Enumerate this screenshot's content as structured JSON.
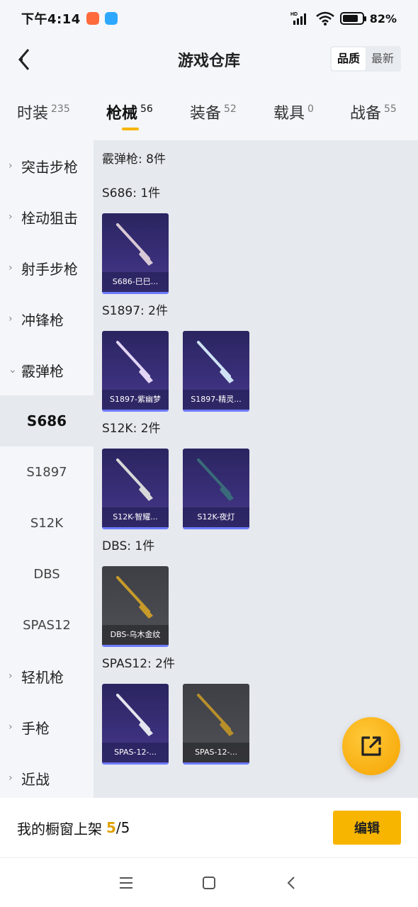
{
  "status_bar": {
    "time": "下午4:14",
    "battery": "82%",
    "hd_label": "HD",
    "battery_level": 0.82
  },
  "header": {
    "title": "游戏仓库",
    "sort_options": [
      "品质",
      "最新"
    ],
    "sort_active": "品质"
  },
  "category_tabs": [
    {
      "label": "时装",
      "count": "235"
    },
    {
      "label": "枪械",
      "count": "56",
      "active": true
    },
    {
      "label": "装备",
      "count": "52"
    },
    {
      "label": "载具",
      "count": "0"
    },
    {
      "label": "战备",
      "count": "55"
    }
  ],
  "side_nav": {
    "items": [
      {
        "label": "突击步枪",
        "chevron": "right"
      },
      {
        "label": "栓动狙击",
        "chevron": "right"
      },
      {
        "label": "射手步枪",
        "chevron": "right"
      },
      {
        "label": "冲锋枪",
        "chevron": "right"
      },
      {
        "label": "霰弹枪",
        "chevron": "down"
      }
    ],
    "sub_items": [
      {
        "label": "S686",
        "active": true
      },
      {
        "label": "S1897"
      },
      {
        "label": "S12K"
      },
      {
        "label": "DBS"
      },
      {
        "label": "SPAS12"
      }
    ],
    "items_after": [
      {
        "label": "轻机枪"
      },
      {
        "label": "手枪"
      },
      {
        "label": "近战"
      }
    ]
  },
  "content": {
    "summary": "霰弹枪: 8件",
    "groups": [
      {
        "title": "S686: 1件",
        "cards": [
          {
            "label": "S686-巳巳...",
            "style": "purple",
            "gun_color": "#d9c9d6"
          }
        ]
      },
      {
        "title": "S1897: 2件",
        "cards": [
          {
            "label": "S1897-紫幽梦",
            "style": "purple",
            "gun_color": "#e2d5f5"
          },
          {
            "label": "S1897-精灵...",
            "style": "purple",
            "gun_color": "#cfe2f5"
          }
        ]
      },
      {
        "title": "S12K: 2件",
        "cards": [
          {
            "label": "S12K-智耀...",
            "style": "purple",
            "gun_color": "#d8d8d8"
          },
          {
            "label": "S12K-夜灯",
            "style": "purple",
            "gun_color": "#3a6b7a"
          }
        ]
      },
      {
        "title": "DBS: 1件",
        "cards": [
          {
            "label": "DBS-乌木金纹",
            "style": "gray",
            "gun_color": "#c79b2a"
          }
        ]
      },
      {
        "title": "SPAS12: 2件",
        "cards": [
          {
            "label": "SPAS-12-...",
            "style": "purple",
            "gun_color": "#e5e5ee"
          },
          {
            "label": "SPAS-12-...",
            "style": "gray",
            "gun_color": "#b78f2a"
          }
        ]
      }
    ]
  },
  "bottom_bar": {
    "label": "我的橱窗上架",
    "count": "5",
    "separator": "/",
    "total": "5",
    "edit_label": "编辑"
  },
  "colors": {
    "accent": "#f7b500",
    "card_purple": "#3a2f7a",
    "card_gray": "#505156"
  }
}
